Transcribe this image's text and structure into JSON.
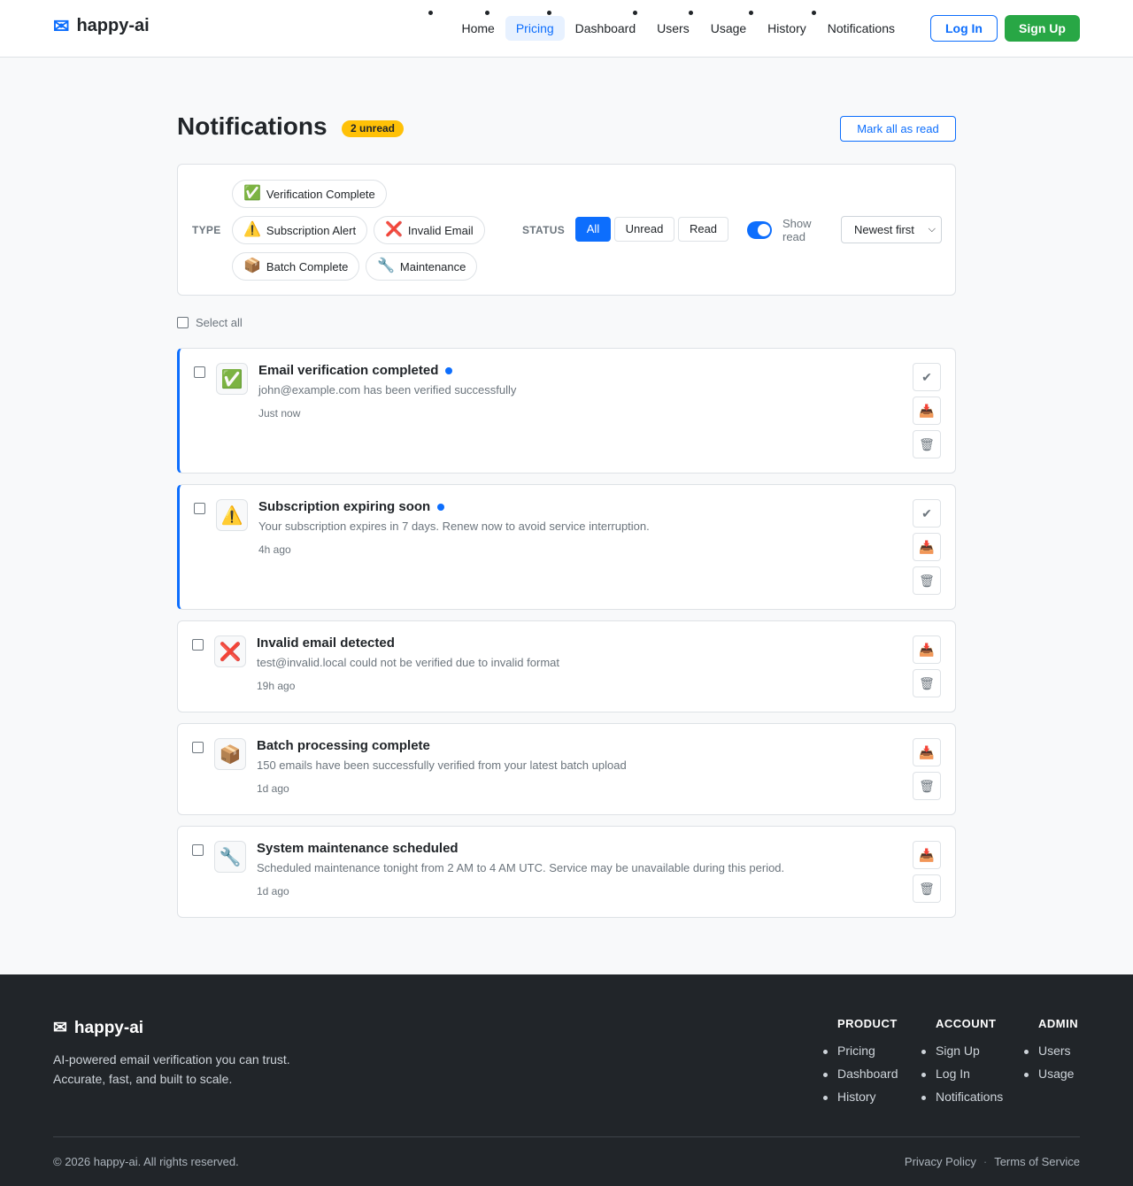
{
  "brand": {
    "icon": "envelope-icon",
    "name": "happy-ai"
  },
  "nav": {
    "links": [
      "Home",
      "Pricing",
      "Dashboard",
      "Users",
      "Usage",
      "History",
      "Notifications"
    ],
    "active": "Pricing",
    "login": "Log In",
    "signup": "Sign Up"
  },
  "header": {
    "title": "Notifications",
    "unread_badge": "2 unread",
    "mark_all": "Mark all as read"
  },
  "filters": {
    "type_label": "TYPE",
    "types": [
      {
        "icon": "✅",
        "label": "Verification Complete"
      },
      {
        "icon": "⚠️",
        "label": "Subscription Alert"
      },
      {
        "icon": "❌",
        "label": "Invalid Email"
      },
      {
        "icon": "📦",
        "label": "Batch Complete"
      },
      {
        "icon": "🔧",
        "label": "Maintenance"
      }
    ],
    "status_label": "STATUS",
    "status_options": [
      "All",
      "Unread",
      "Read"
    ],
    "status_selected": "All",
    "show_read_label": "Show read",
    "show_read": true,
    "sort": "Newest first"
  },
  "select_all": "Select all",
  "notifications": [
    {
      "icon": "✅",
      "title": "Email verification completed",
      "message": "john@example.com has been verified successfully",
      "time": "Just now",
      "unread": true
    },
    {
      "icon": "⚠️",
      "title": "Subscription expiring soon",
      "message": "Your subscription expires in 7 days. Renew now to avoid service interruption.",
      "time": "4h ago",
      "unread": true
    },
    {
      "icon": "❌",
      "title": "Invalid email detected",
      "message": "test@invalid.local could not be verified due to invalid format",
      "time": "19h ago",
      "unread": false
    },
    {
      "icon": "📦",
      "title": "Batch processing complete",
      "message": "150 emails have been successfully verified from your latest batch upload",
      "time": "1d ago",
      "unread": false
    },
    {
      "icon": "🔧",
      "title": "System maintenance scheduled",
      "message": "Scheduled maintenance tonight from 2 AM to 4 AM UTC. Service may be unavailable during this period.",
      "time": "1d ago",
      "unread": false
    }
  ],
  "actions": {
    "mark_read_icon": "✔",
    "archive_icon": "📥",
    "delete_icon": "🗑"
  },
  "footer": {
    "brand": "happy-ai",
    "tagline": "AI-powered email verification you can trust. Accurate, fast, and built to scale.",
    "columns": [
      {
        "title": "PRODUCT",
        "links": [
          "Pricing",
          "Dashboard",
          "History"
        ]
      },
      {
        "title": "ACCOUNT",
        "links": [
          "Sign Up",
          "Log In",
          "Notifications"
        ]
      },
      {
        "title": "ADMIN",
        "links": [
          "Users",
          "Usage"
        ]
      }
    ],
    "copyright": "© 2026 happy-ai. All rights reserved.",
    "privacy": "Privacy Policy",
    "separator": "·",
    "terms": "Terms of Service"
  },
  "colors": {
    "primary": "#0d6efd",
    "success": "#28a745",
    "warning": "#ffc107",
    "footer_bg": "#212529"
  }
}
